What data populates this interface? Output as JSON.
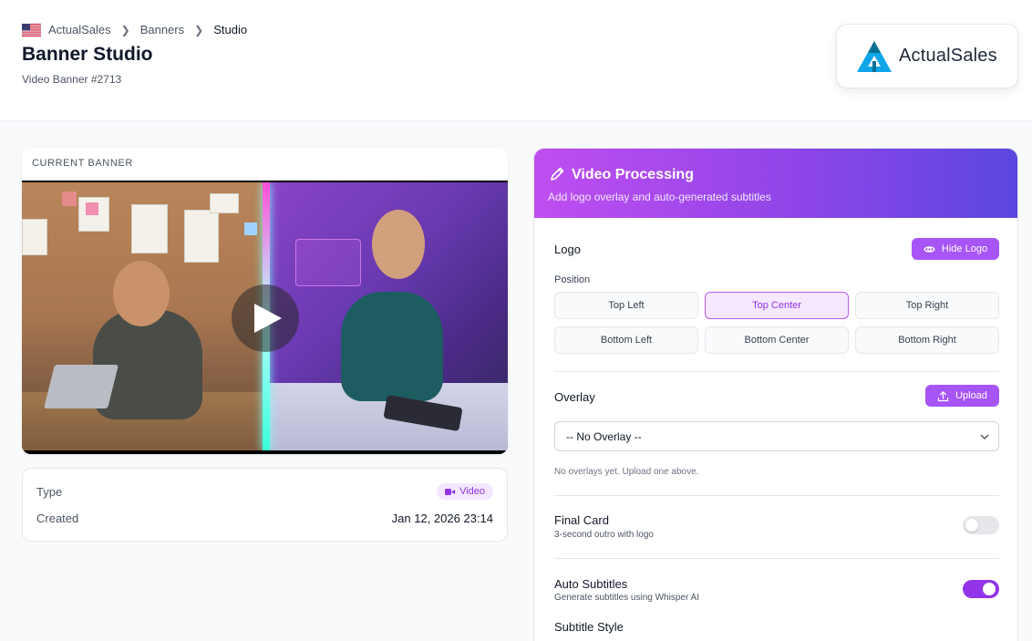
{
  "breadcrumb": {
    "root": "ActualSales",
    "middle": "Banners",
    "current": "Studio"
  },
  "page": {
    "title": "Banner Studio",
    "subtitle": "Video Banner #2713"
  },
  "brand": {
    "name": "ActualSales"
  },
  "current_banner": {
    "heading": "CURRENT BANNER"
  },
  "meta": {
    "type_label": "Type",
    "type_value": "Video",
    "created_label": "Created",
    "created_value": "Jan 12, 2026 23:14"
  },
  "processing": {
    "title": "Video Processing",
    "subtitle": "Add logo overlay and auto-generated subtitles",
    "logo": {
      "label": "Logo",
      "hide_button": "Hide Logo",
      "position_label": "Position",
      "positions": [
        "Top Left",
        "Top Center",
        "Top Right",
        "Bottom Left",
        "Bottom Center",
        "Bottom Right"
      ],
      "selected": "Top Center"
    },
    "overlay": {
      "label": "Overlay",
      "upload_button": "Upload",
      "selected": "-- No Overlay --",
      "hint": "No overlays yet. Upload one above."
    },
    "final_card": {
      "label": "Final Card",
      "desc": "3-second outro with logo",
      "enabled": false
    },
    "auto_subtitles": {
      "label": "Auto Subtitles",
      "desc": "Generate subtitles using Whisper AI",
      "enabled": true
    },
    "subtitle_style": {
      "label": "Subtitle Style"
    }
  },
  "colors": {
    "accent": "#a855f7",
    "accent_dark": "#9333ea",
    "brand": "#0ea5e9"
  }
}
